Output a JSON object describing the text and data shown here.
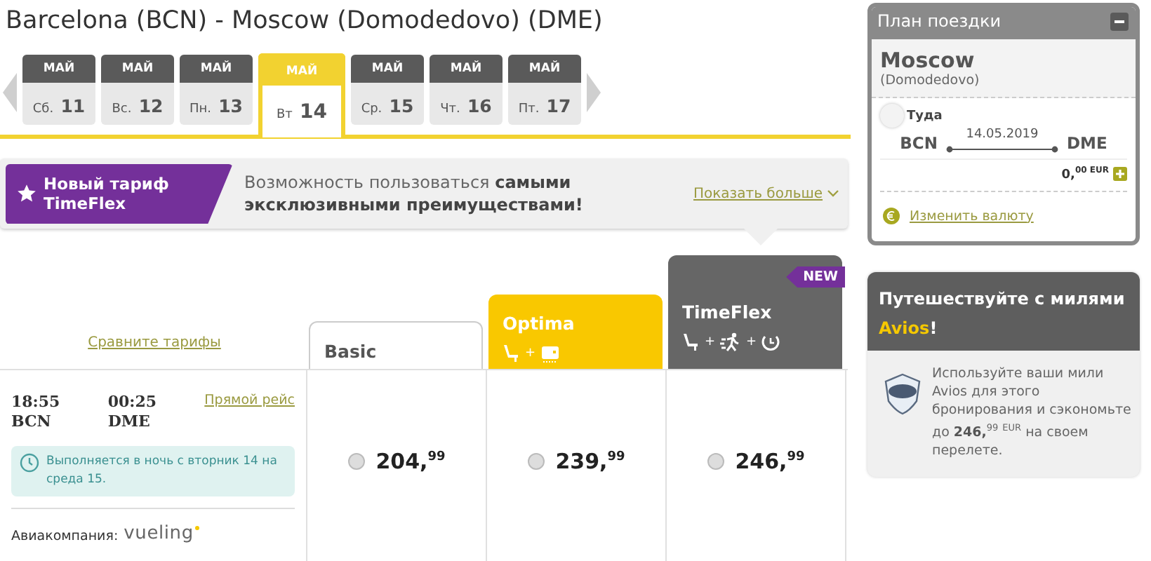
{
  "route_title": "Barcelona (BCN) - Moscow (Domodedovo) (DME)",
  "dates": [
    {
      "month": "МАЙ",
      "weekday": "Сб.",
      "day": "11",
      "selected": false
    },
    {
      "month": "МАЙ",
      "weekday": "Вс.",
      "day": "12",
      "selected": false
    },
    {
      "month": "МАЙ",
      "weekday": "Пн.",
      "day": "13",
      "selected": false
    },
    {
      "month": "МАЙ",
      "weekday": "Вт",
      "day": "14",
      "selected": true
    },
    {
      "month": "МАЙ",
      "weekday": "Ср.",
      "day": "15",
      "selected": false
    },
    {
      "month": "МАЙ",
      "weekday": "Чт.",
      "day": "16",
      "selected": false
    },
    {
      "month": "МАЙ",
      "weekday": "Пт.",
      "day": "17",
      "selected": false
    }
  ],
  "promo": {
    "tag": "Новый тариф TimeFlex",
    "text": "Возможность пользоваться **самыми эксклюзивными преимуществами!**",
    "link": "Показать больше"
  },
  "compare_link": "Сравните тарифы",
  "fare_joiner": "+",
  "fares": [
    {
      "kind": "basic",
      "name": "Basic",
      "price": "204,$^{99}$",
      "selected": false
    },
    {
      "kind": "optima",
      "name": "Optima",
      "price": "239,$^{99}$",
      "selected": false
    },
    {
      "kind": "timeflex",
      "name": "TimeFlex",
      "badge": "NEW",
      "price": "246,$^{99}$",
      "selected": false
    }
  ],
  "flight": {
    "dep_time": "18:55",
    "dep_code": "BCN",
    "arr_time": "00:25",
    "arr_code": "DME",
    "type_link": "Прямой рейс",
    "notice": "Выполняется в ночь с вторник 14 на среда 15.",
    "airline_label": "Авиакомпания:",
    "airline": "vueling"
  },
  "trip_plan": {
    "title": "План поездки",
    "city": "Moscow",
    "airport": "(Domodedovo)",
    "leg": "Туда",
    "from": "BCN",
    "date": "14.05.2019",
    "to": "DME",
    "total": "0,$^{00 EUR}$",
    "currency_link": "Изменить валюту"
  },
  "avios": {
    "title": "Путешествуйте с милями **Avios**!",
    "text": "Используйте ваши мили Avios для этого бронирования и сэкономьте до **246,**$^{99}$ $^{EUR}$ на своем перелете."
  }
}
